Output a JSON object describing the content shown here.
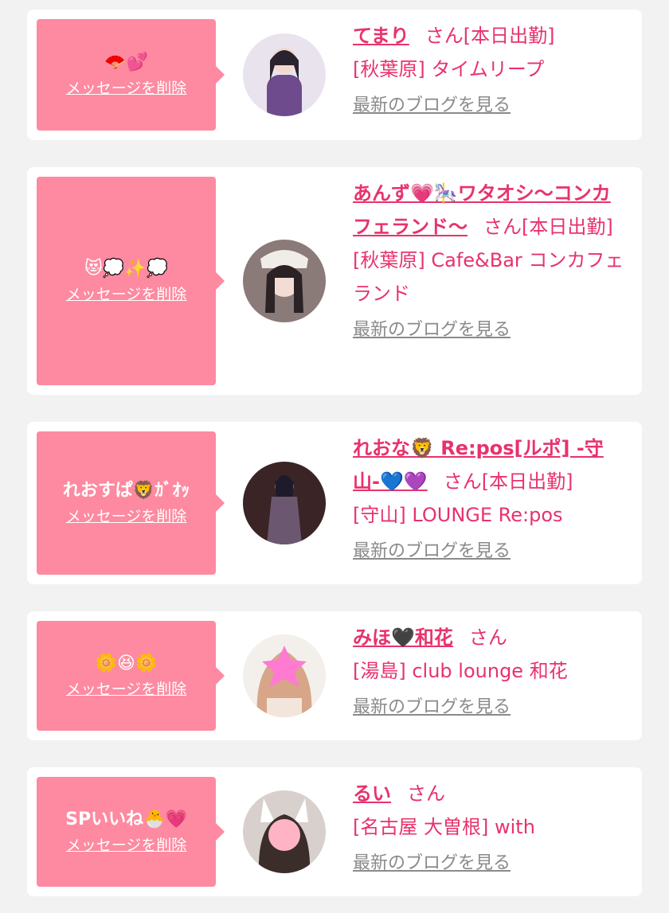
{
  "items": [
    {
      "message": "🪭💕",
      "delete_label": "メッセージを削除",
      "name": "てまり",
      "suffix": "さん[本日出勤]",
      "shop": "[秋葉原] タイムリープ",
      "blog_label": "最新のブログを見る",
      "avatar_colors": [
        "#e9e3ee",
        "#6d4b8d",
        "#2b2230"
      ]
    },
    {
      "message": "😻💭✨💭",
      "delete_label": "メッセージを削除",
      "name": "あんず💗🎠ワタオシ〜コンカフェランド〜",
      "suffix": "さん[本日出勤]",
      "shop": "[秋葉原] Cafe&Bar コンカフェランド",
      "blog_label": "最新のブログを見る",
      "avatar_colors": [
        "#8a7a78",
        "#f0ece8",
        "#2a2224"
      ]
    },
    {
      "message": "れおすぱ🦁ｶﾞｵｯ",
      "delete_label": "メッセージを削除",
      "name": "れおな🦁 Re:pos[ルポ] -守山-💙💜",
      "suffix": "さん[本日出勤]",
      "shop": "[守山] LOUNGE Re:pos",
      "blog_label": "最新のブログを見る",
      "avatar_colors": [
        "#3a2426",
        "#6b5870",
        "#1e1a2a"
      ]
    },
    {
      "message": "🌼😆🌼",
      "delete_label": "メッセージを削除",
      "name": "みほ🖤和花",
      "suffix": "さん",
      "shop": "[湯島] club lounge 和花",
      "blog_label": "最新のブログを見る",
      "avatar_colors": [
        "#f3f0ec",
        "#d7a688",
        "#ff7ad0"
      ]
    },
    {
      "message": "SPいいね🐣💗",
      "delete_label": "メッセージを削除",
      "name": "るい",
      "suffix": "さん",
      "shop": "[名古屋 大曽根] with",
      "blog_label": "最新のブログを見る",
      "avatar_colors": [
        "#d7d0cc",
        "#ffffff",
        "#ffb4c6"
      ]
    }
  ]
}
